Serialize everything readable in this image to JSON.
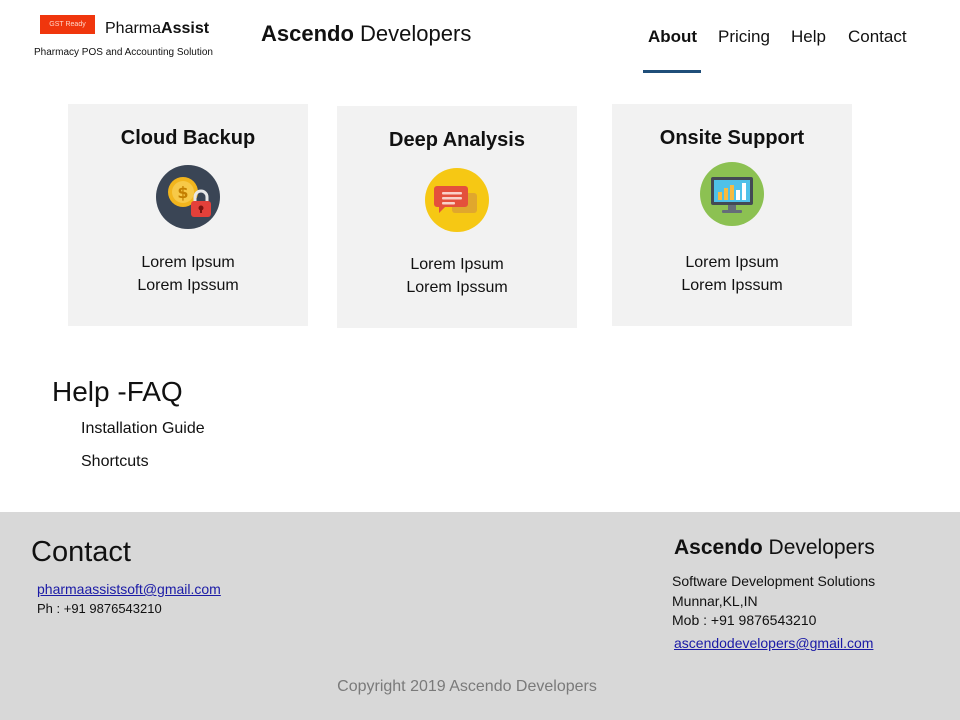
{
  "header": {
    "gst_badge": "GST Ready",
    "brand_light": "Pharma",
    "brand_bold": "Assist",
    "tagline": "Pharmacy POS and Accounting Solution",
    "company_bold": "Ascendo",
    "company_light": " Developers"
  },
  "nav": {
    "items": [
      {
        "label": "About"
      },
      {
        "label": "Pricing"
      },
      {
        "label": "Help"
      },
      {
        "label": "Contact"
      }
    ],
    "active": "About",
    "active_color": "#1f4e79"
  },
  "features": [
    {
      "title": "Cloud Backup",
      "icon": "coin-lock-icon",
      "line1": "Lorem Ipsum",
      "line2": "Lorem Ipssum"
    },
    {
      "title": "Deep Analysis",
      "icon": "chat-bubble-icon",
      "line1": "Lorem Ipsum",
      "line2": "Lorem Ipssum"
    },
    {
      "title": "Onsite Support",
      "icon": "monitor-chart-icon",
      "line1": "Lorem Ipsum",
      "line2": "Lorem Ipssum"
    }
  ],
  "faq": {
    "title": "Help -FAQ",
    "links": [
      {
        "label": "Installation  Guide"
      },
      {
        "label": "Shortcuts"
      }
    ]
  },
  "footer": {
    "contact_title": "Contact",
    "email": "pharmaassistsoft@gmail.com",
    "phone": "Ph : +91 9876543210",
    "company_bold": "Ascendo",
    "company_light": " Developers",
    "company_tagline": "Software Development Solutions",
    "company_location": "Munnar,KL,IN",
    "company_mobile": "Mob :  +91 9876543210",
    "company_email": "ascendodevelopers@gmail.com",
    "copyright": "Copyright  2019 Ascendo Developers",
    "background": "#d8d8d8",
    "link_color": "#1a1aa6"
  },
  "colors": {
    "gst_badge": "#f0360d",
    "card_background": "#f2f2f2"
  }
}
